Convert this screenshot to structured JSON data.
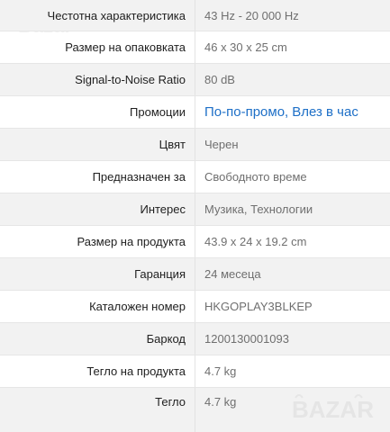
{
  "specs": [
    {
      "label": "Честотна характеристика",
      "value": "43 Hz - 20 000 Hz"
    },
    {
      "label": "Размер на опаковката",
      "value": "46 x 30 x 25 cm"
    },
    {
      "label": "Signal-to-Noise Ratio",
      "value": "80 dB"
    },
    {
      "label": "Промоции",
      "links": [
        "По-по-промо",
        "Влез в час"
      ]
    },
    {
      "label": "Цвят",
      "value": "Черен"
    },
    {
      "label": "Предназначен за",
      "value": "Свободното време"
    },
    {
      "label": "Интерес",
      "value": "Музика, Технологии"
    },
    {
      "label": "Размер на продукта",
      "value": "43.9 x 24 x 19.2 cm"
    },
    {
      "label": "Гаранция",
      "value": "24 месеца"
    },
    {
      "label": "Каталожен номер",
      "value": "HKGOPLAY3BLKEP"
    },
    {
      "label": "Баркод",
      "value": "1200130001093"
    },
    {
      "label": "Тегло на продукта",
      "value": "4.7 kg"
    },
    {
      "label": "Тегло",
      "value": "4.7 kg"
    }
  ],
  "promo_separator": ",",
  "watermark": {
    "top_text": "Bazar",
    "logo_text": "BAZAR",
    "logo_color": "#e5e5e5"
  },
  "colors": {
    "link": "#1d6fc7",
    "label": "#212121",
    "value": "#6f6f6f",
    "row_shade": "#f2f2f2"
  }
}
